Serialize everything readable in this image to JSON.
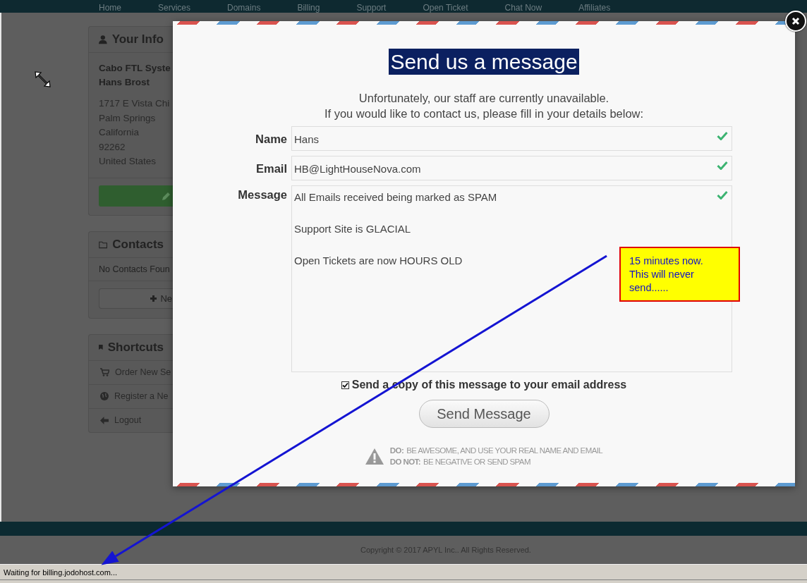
{
  "nav": {
    "items": [
      "Home",
      "Services",
      "Domains",
      "Billing",
      "Support",
      "Open Ticket",
      "Chat Now",
      "Affiliates"
    ]
  },
  "sidebar": {
    "panels": [
      {
        "kind": "info",
        "title": "Your Info",
        "name_lines": [
          "Cabo FTL Syste",
          "Hans Brost"
        ],
        "address_lines": [
          "1717 E Vista Chi",
          "Palm Springs",
          "California",
          "92262",
          "United States"
        ]
      },
      {
        "kind": "contacts",
        "title": "Contacts",
        "message": "No Contacts Foun",
        "button": "Ne"
      },
      {
        "kind": "shortcuts",
        "title": "Shortcuts",
        "links": [
          {
            "label": "Order New Se"
          },
          {
            "label": "Register a Ne"
          },
          {
            "label": "Logout"
          }
        ]
      }
    ]
  },
  "modal": {
    "title": "Send us a message",
    "intro": [
      "Unfortunately, our staff are currently unavailable.",
      "If you would like to contact us, please fill in your details below:"
    ],
    "fields": [
      {
        "kind": "line",
        "label": "Name",
        "value": "Hans",
        "valid": true
      },
      {
        "kind": "line",
        "label": "Email",
        "value": "HB@LightHouseNova.com",
        "valid": true
      },
      {
        "kind": "area",
        "label": "Message",
        "value": "All Emails received being marked as SPAM\n\nSupport Site is GLACIAL\n\nOpen Tickets are now HOURS OLD",
        "valid": true
      }
    ],
    "copy": {
      "label": "Send a copy of this message to your email address",
      "checked": true
    },
    "button": "Send Message",
    "rules": [
      {
        "label": "DO:",
        "text": "BE AWESOME, AND USE YOUR REAL NAME AND EMAIL"
      },
      {
        "label": "DO NOT:",
        "text": "BE NEGATIVE OR SEND SPAM"
      }
    ]
  },
  "annotation": {
    "lines": [
      "15 minutes now.",
      "This will never",
      "send......"
    ]
  },
  "footer": {
    "copyright": "Copyright © 2017 APYL Inc.. All Rights Reserved."
  },
  "status_bar": {
    "text": "Waiting for billing.jodohost.com..."
  }
}
